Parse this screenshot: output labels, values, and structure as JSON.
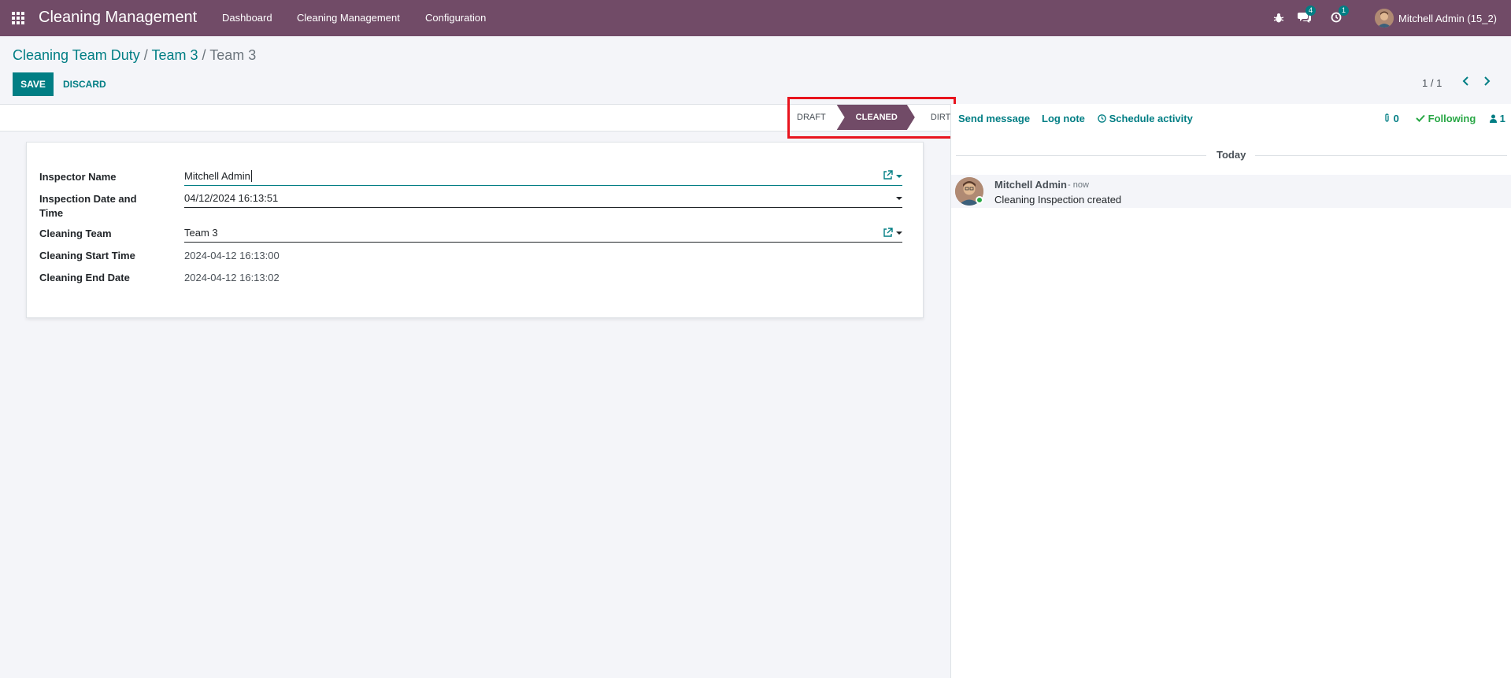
{
  "navbar": {
    "brand": "Cleaning Management",
    "menu": [
      "Dashboard",
      "Cleaning Management",
      "Configuration"
    ],
    "messages_count": "4",
    "activities_count": "1",
    "user": "Mitchell Admin (15_2)"
  },
  "breadcrumb": {
    "items": [
      "Cleaning Team Duty",
      "Team 3"
    ],
    "current": "Team 3",
    "separator": "/"
  },
  "actions": {
    "save": "SAVE",
    "discard": "DISCARD"
  },
  "pager": {
    "value": "1 / 1"
  },
  "statusbar": {
    "stages": [
      "DRAFT",
      "CLEANED",
      "DIRTY"
    ],
    "active": "CLEANED"
  },
  "form": {
    "inspector_name": {
      "label": "Inspector Name",
      "value": "Mitchell Admin"
    },
    "inspection_date": {
      "label": "Inspection Date and Time",
      "value": "04/12/2024 16:13:51"
    },
    "cleaning_team": {
      "label": "Cleaning Team",
      "value": "Team 3"
    },
    "start_time": {
      "label": "Cleaning Start Time",
      "value": "2024-04-12 16:13:00"
    },
    "end_date": {
      "label": "Cleaning End Date",
      "value": "2024-04-12 16:13:02"
    }
  },
  "chatter": {
    "send_message": "Send message",
    "log_note": "Log note",
    "schedule_activity": "Schedule activity",
    "attachments": "0",
    "following": "Following",
    "followers": "1",
    "today": "Today",
    "message": {
      "author": "Mitchell Admin",
      "date": "- now",
      "body": "Cleaning Inspection created"
    }
  },
  "colors": {
    "brand": "#714b67",
    "accent": "#017e84",
    "highlight": "#e8141e",
    "following": "#28a745"
  }
}
